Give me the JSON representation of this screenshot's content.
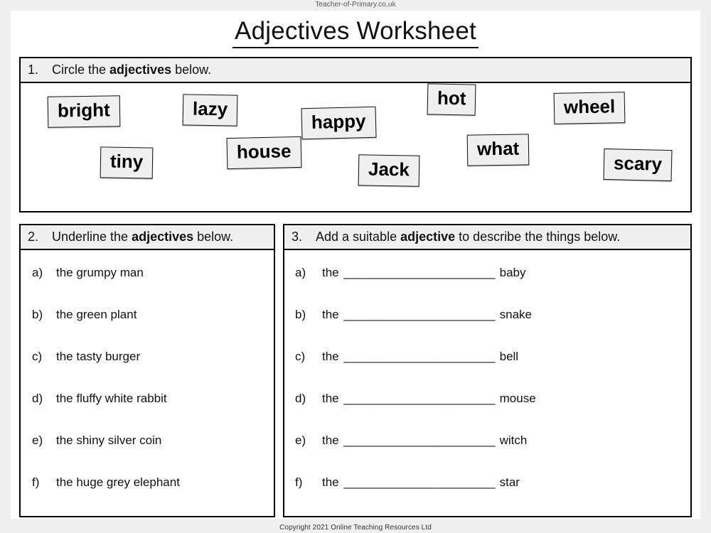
{
  "site": {
    "header": "Teacher-of-Primary.co.uk",
    "footer": "Copyright 2021 Online Teaching Resources Ltd"
  },
  "title": "Adjectives Worksheet",
  "questions": {
    "q1": {
      "number": "1.",
      "instruction_before": "Circle the ",
      "instruction_bold": "adjectives",
      "instruction_after": " below.",
      "words": [
        {
          "text": "bright"
        },
        {
          "text": "lazy"
        },
        {
          "text": "happy"
        },
        {
          "text": "hot"
        },
        {
          "text": "wheel"
        },
        {
          "text": "tiny"
        },
        {
          "text": "house"
        },
        {
          "text": "Jack"
        },
        {
          "text": "what"
        },
        {
          "text": "scary"
        }
      ]
    },
    "q2": {
      "number": "2.",
      "instruction_before": "Underline the ",
      "instruction_bold": "adjectives",
      "instruction_after": " below.",
      "items": [
        {
          "label": "a)",
          "text": "the grumpy man"
        },
        {
          "label": "b)",
          "text": "the green plant"
        },
        {
          "label": "c)",
          "text": "the tasty burger"
        },
        {
          "label": "d)",
          "text": "the fluffy white rabbit"
        },
        {
          "label": "e)",
          "text": "the shiny silver coin"
        },
        {
          "label": "f)",
          "text": "the huge grey elephant"
        }
      ]
    },
    "q3": {
      "number": "3.",
      "instruction_before": "Add a suitable ",
      "instruction_bold": "adjective",
      "instruction_after": " to describe the things below.",
      "blank": "________________________",
      "items": [
        {
          "label": "a)",
          "prefix": "the",
          "noun": "baby"
        },
        {
          "label": "b)",
          "prefix": "the",
          "noun": "snake"
        },
        {
          "label": "c)",
          "prefix": "the",
          "noun": "bell"
        },
        {
          "label": "d)",
          "prefix": "the",
          "noun": "mouse"
        },
        {
          "label": "e)",
          "prefix": "the",
          "noun": "witch"
        },
        {
          "label": "f)",
          "prefix": "the",
          "noun": "star"
        }
      ]
    }
  },
  "colors": {
    "page": "#ffffff",
    "margin": "#f0f0f0",
    "ink": "#000000",
    "band": "#f0f0f0"
  }
}
